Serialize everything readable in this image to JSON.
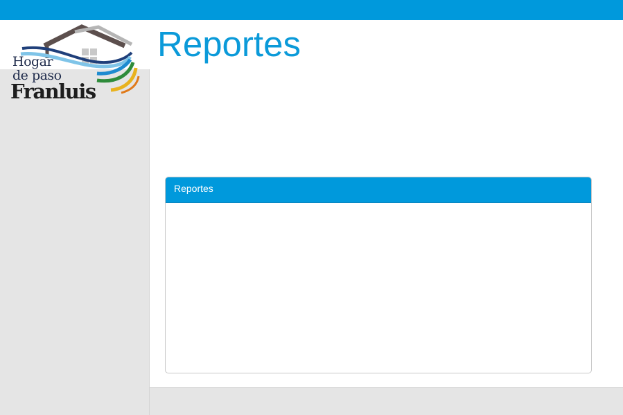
{
  "header": {
    "title": "Reportes",
    "accent_color": "#0099dc"
  },
  "logo": {
    "line1": "Hogar",
    "line2": "de paso",
    "line3": "Franluis",
    "icon": "house-logo-icon"
  },
  "panel": {
    "title": "Reportes"
  },
  "colors": {
    "primary": "#0099dc",
    "sidebar_bg": "#e5e5e5",
    "title_text": "#0b9ad9"
  }
}
